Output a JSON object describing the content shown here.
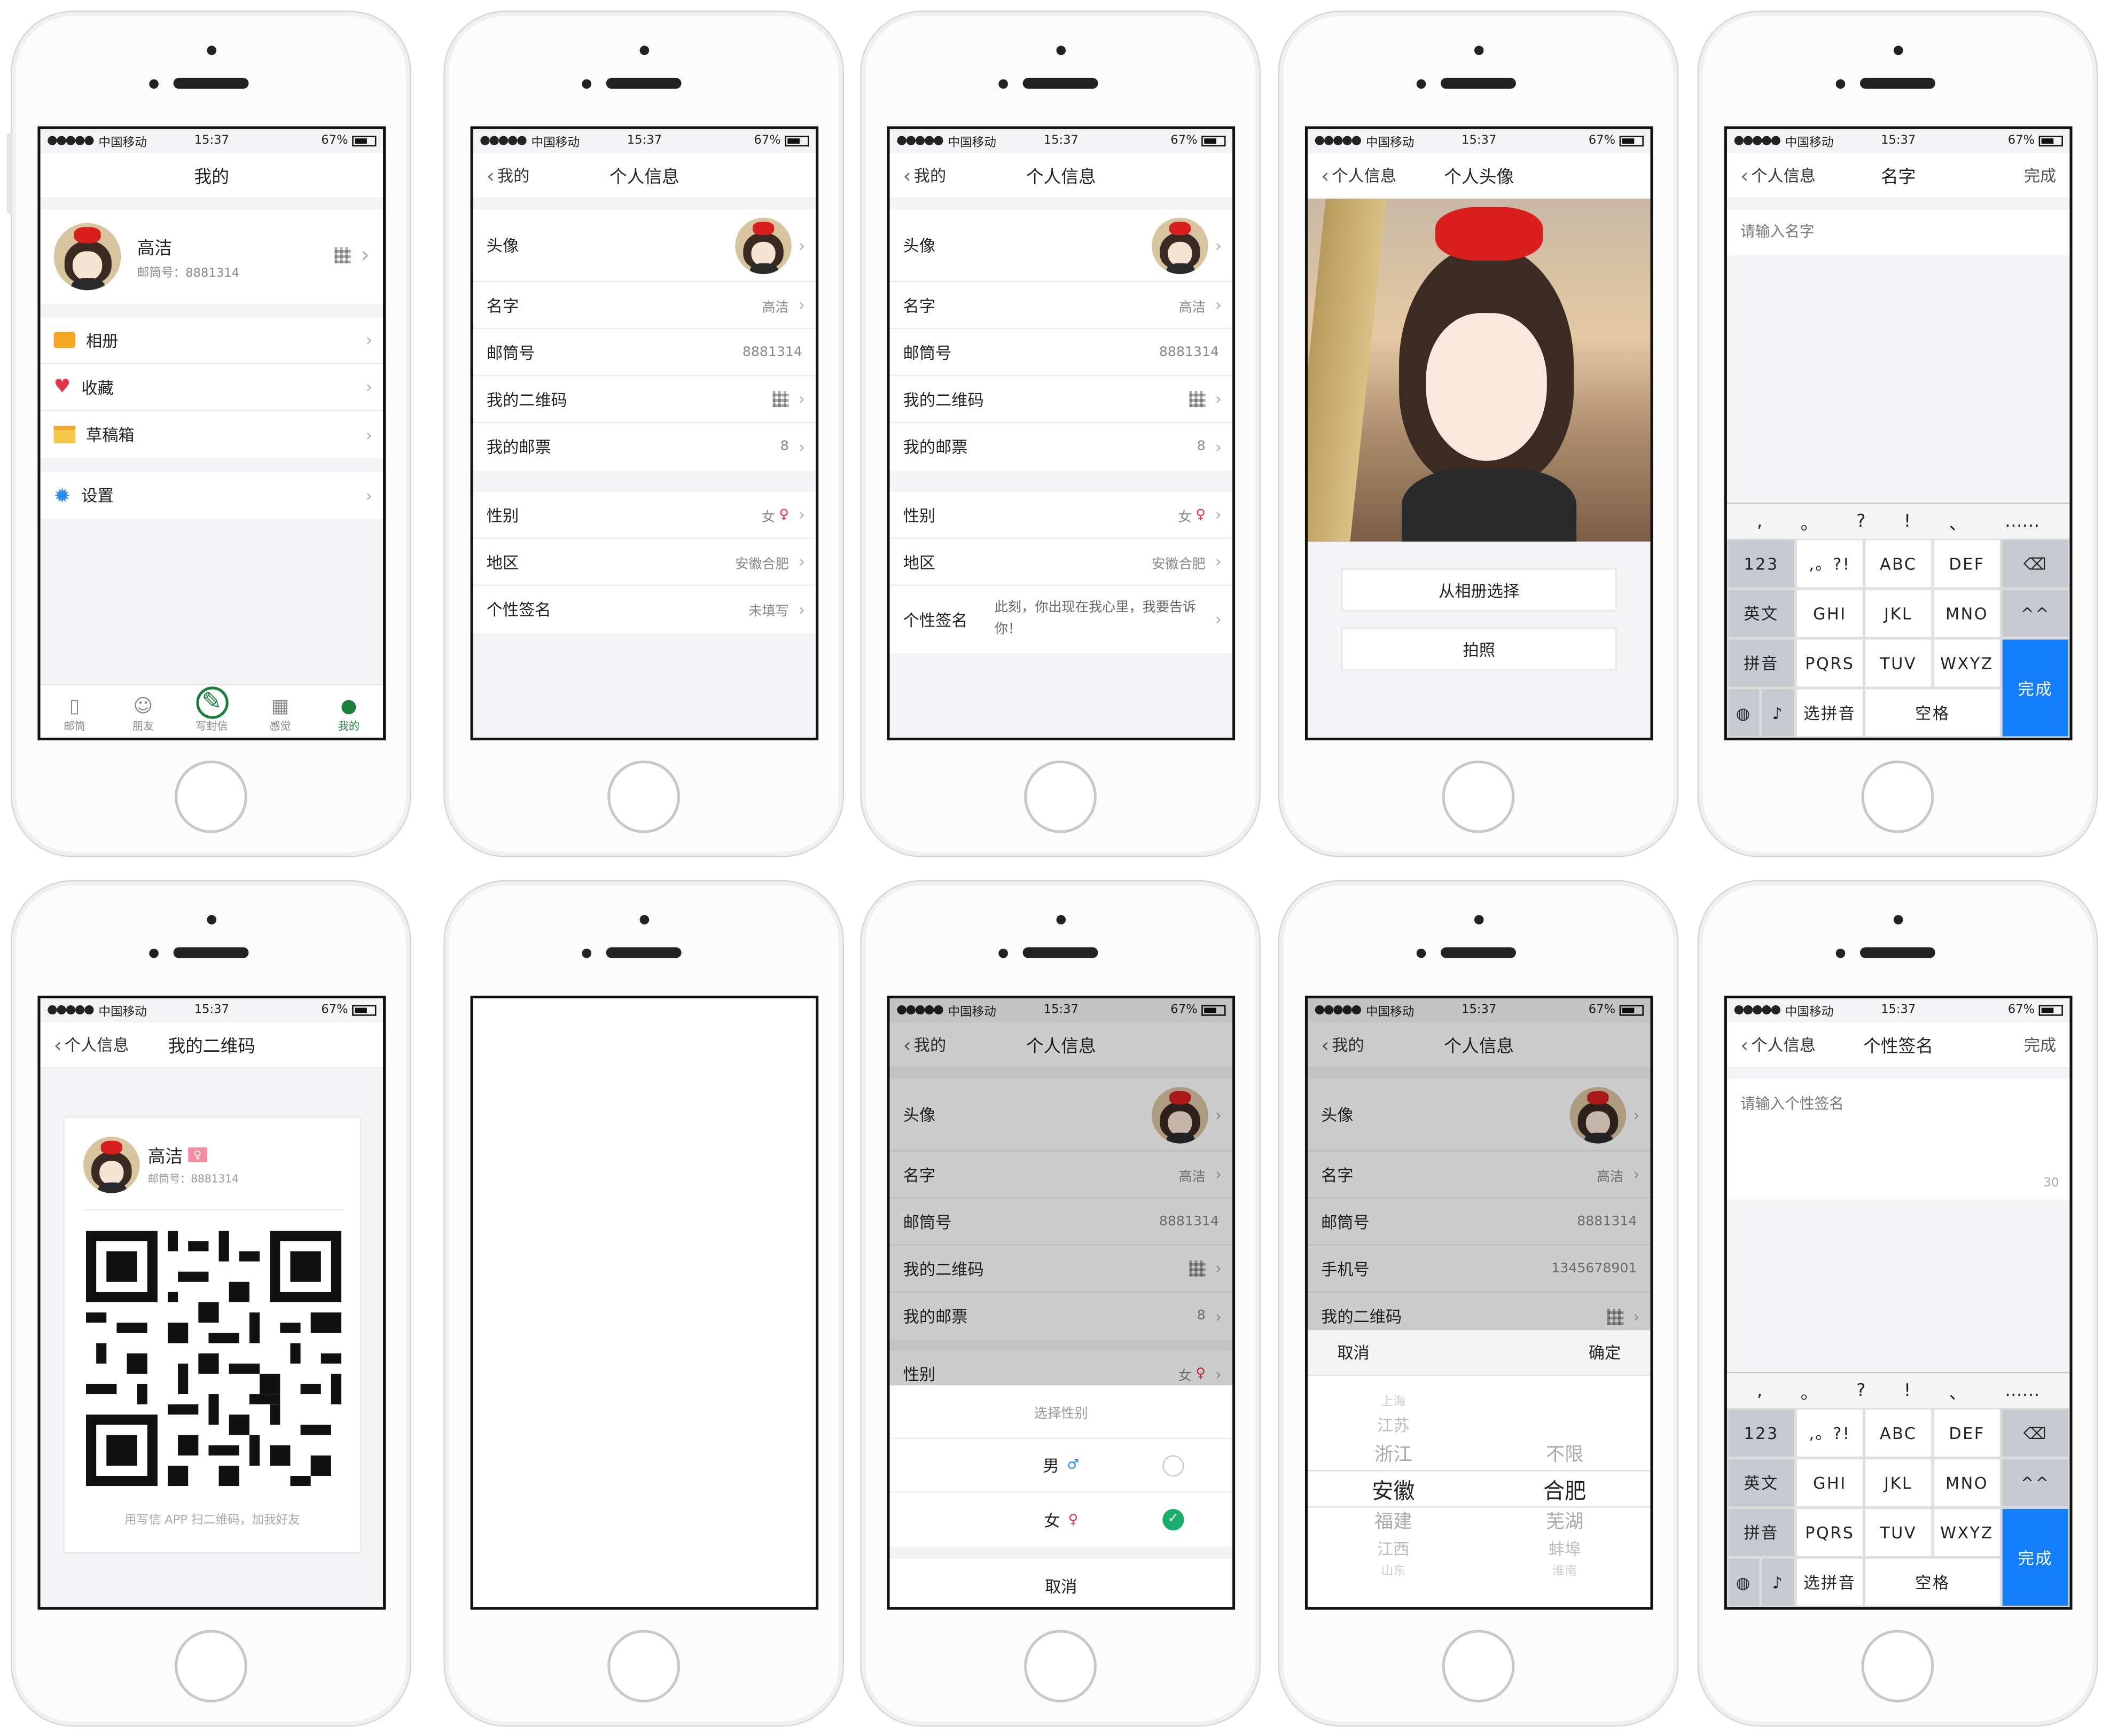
{
  "status": {
    "carrier": "中国移动",
    "time": "15:37",
    "battery": "67%",
    "dots": "●●●●●"
  },
  "p1": {
    "title": "我的",
    "name": "高洁",
    "id_label": "邮筒号：8881314",
    "menu": [
      {
        "label": "相册"
      },
      {
        "label": "收藏"
      },
      {
        "label": "草稿箱"
      }
    ],
    "settings": "设置",
    "tabs": [
      "邮筒",
      "朋友",
      "写封信",
      "感觉",
      "我的"
    ],
    "tab_icons": [
      "▯",
      "☺",
      "✎",
      "▦",
      "●"
    ]
  },
  "info": {
    "title": "个人信息",
    "back": "我的",
    "rows": {
      "avatar": "头像",
      "name": "名字",
      "name_v": "高洁",
      "id": "邮筒号",
      "id_v": "8881314",
      "qr": "我的二维码",
      "stamp": "我的邮票",
      "stamp_v": "8",
      "gender": "性别",
      "gender_v": "女",
      "region": "地区",
      "region_v": "安徽合肥",
      "sig": "个性签名",
      "sig_v": "未填写",
      "sig_v2": "此刻，你出现在我心里，我要告诉你！",
      "phone": "手机号",
      "phone_v": "1345678901"
    }
  },
  "p4": {
    "back": "个人信息",
    "title": "个人头像",
    "btn1": "从相册选择",
    "btn2": "拍照"
  },
  "p5": {
    "back": "个人信息",
    "title": "名字",
    "done": "完成",
    "placeholder": "请输入名字"
  },
  "kb": {
    "punct": [
      ",",
      "。",
      "?",
      "!",
      "、",
      "……"
    ],
    "k123": "123",
    "k1": ",。?!",
    "k2": "ABC",
    "k3": "DEF",
    "en": "英文",
    "k4": "GHI",
    "k5": "JKL",
    "k6": "MNO",
    "emoji": "^^",
    "py": "拼音",
    "k7": "PQRS",
    "k8": "TUV",
    "k9": "WXYZ",
    "done": "完成",
    "sel": "选拼音",
    "space": "空格"
  },
  "p6": {
    "back": "个人信息",
    "title": "我的二维码",
    "name": "高洁",
    "id": "邮筒号：8881314",
    "hint": "用写信 APP 扫二维码，加我好友"
  },
  "p8": {
    "sheet_title": "选择性别",
    "male": "男",
    "female": "女",
    "cancel": "取消"
  },
  "p9": {
    "cancel": "取消",
    "ok": "确定",
    "prov": [
      "上海",
      "江苏",
      "浙江",
      "安徽",
      "福建",
      "江西",
      "山东"
    ],
    "city": [
      "不限",
      "合肥",
      "芜湖",
      "蚌埠",
      "淮南"
    ]
  },
  "p10": {
    "back": "个人信息",
    "title": "个性签名",
    "done": "完成",
    "placeholder": "请输入个性签名",
    "count": "30"
  }
}
